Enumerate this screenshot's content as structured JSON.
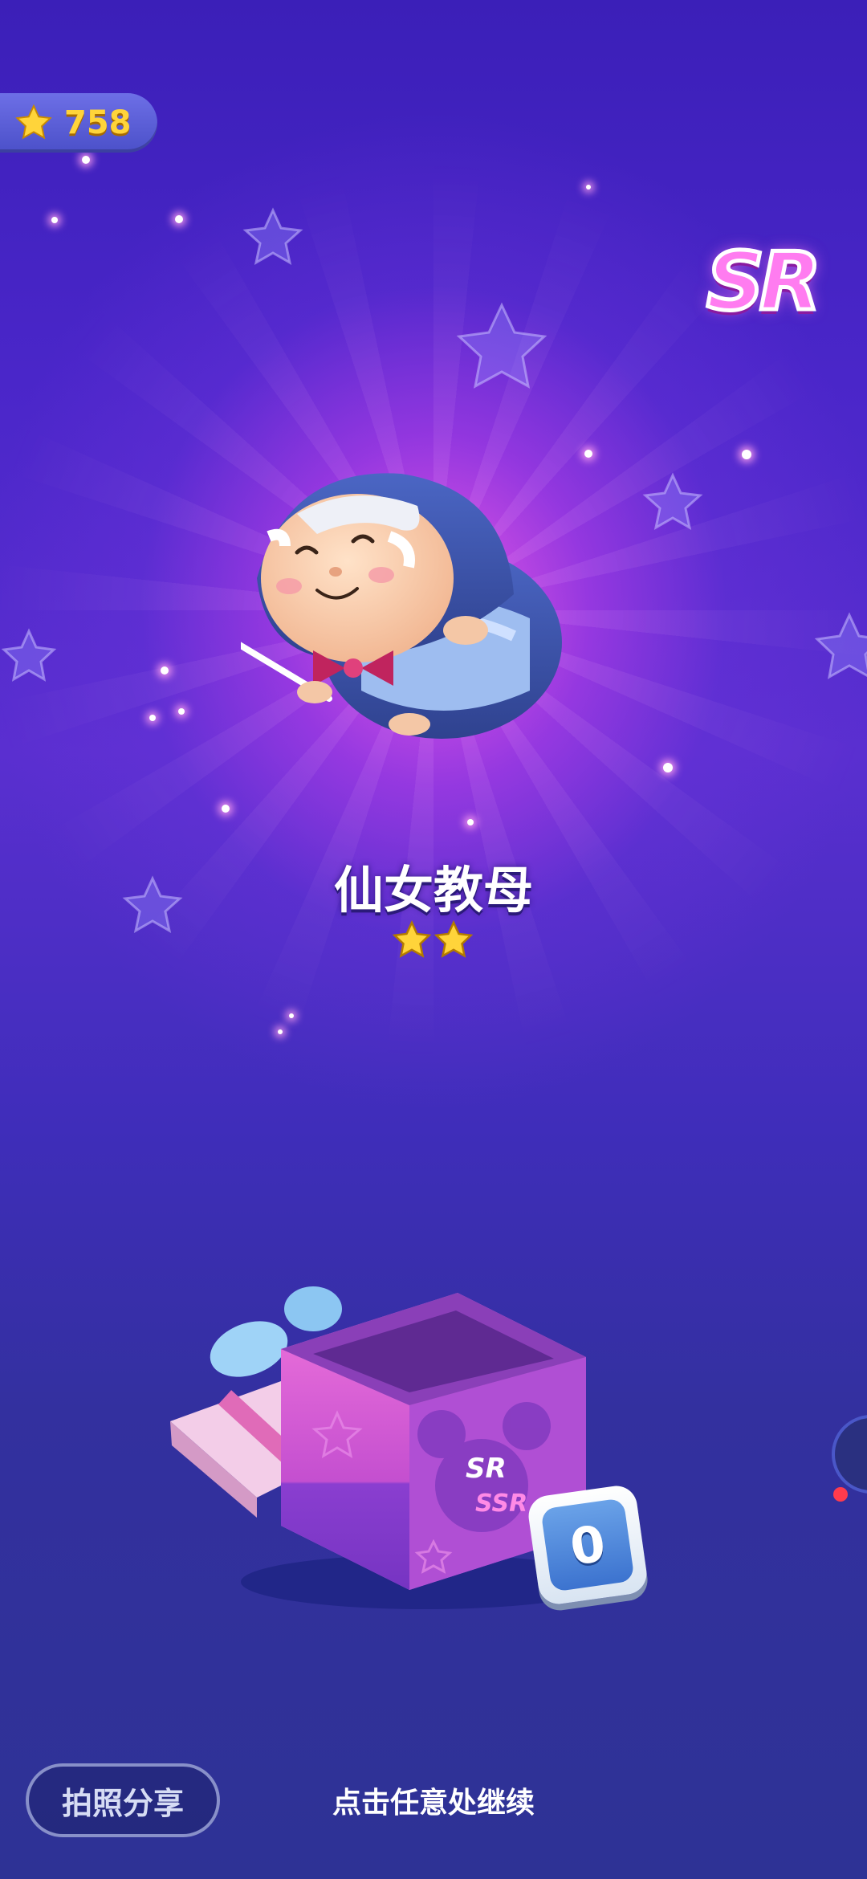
{
  "hud": {
    "currency_icon": "star-icon",
    "currency_amount": "758"
  },
  "reward": {
    "rarity_badge": "SR",
    "character_name": "仙女教母",
    "star_rank": 2
  },
  "giftbox": {
    "box_labels": [
      "SR",
      "SSR"
    ],
    "counter": "0"
  },
  "footer": {
    "share_button": "拍照分享",
    "continue_hint": "点击任意处继续"
  },
  "colors": {
    "background_top": "#3b1fb8",
    "background_bottom": "#2e3295",
    "glow": "#f05ae6",
    "star_gold": "#ffd43a",
    "rarity_pink": "#ff7cf0"
  }
}
